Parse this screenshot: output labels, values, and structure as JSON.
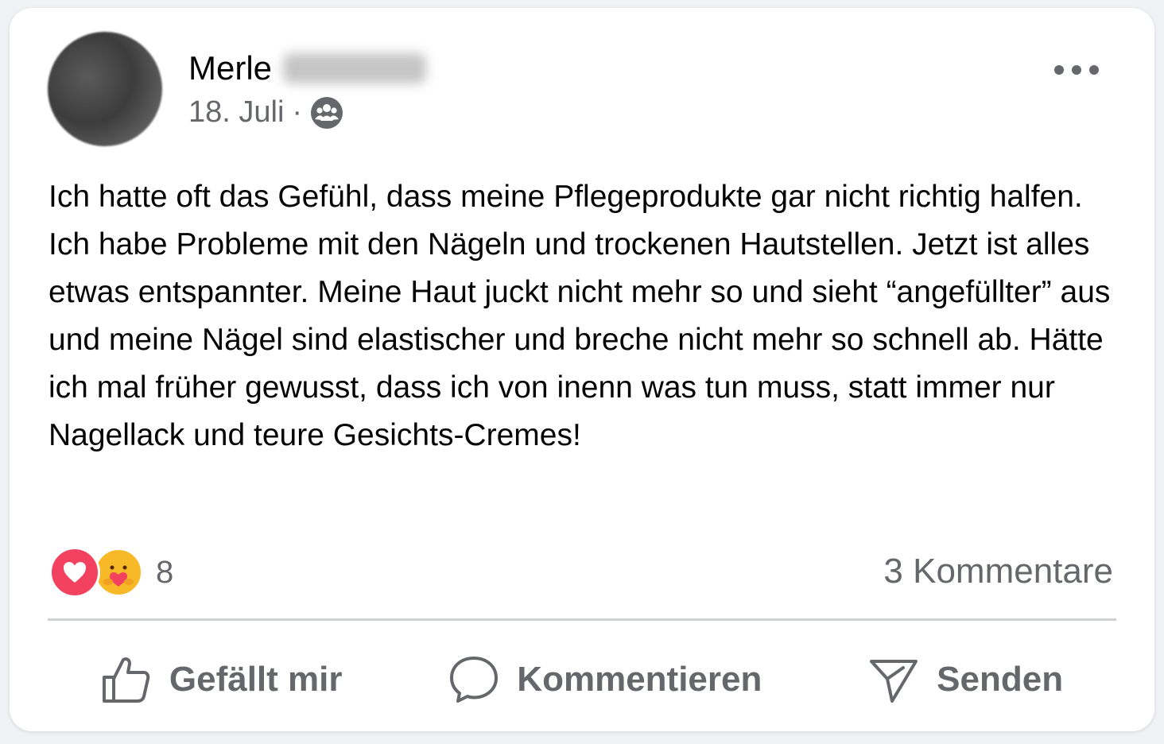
{
  "post": {
    "author_first_name": "Merle",
    "date": "18. Juli",
    "separator": "·",
    "audience_icon": "group-icon",
    "text": "Ich hatte oft das Gefühl, dass meine Pflegeprodukte gar nicht richtig halfen. Ich habe Probleme mit den Nägeln und trockenen Hautstellen. Jetzt ist alles etwas entspannter. Meine Haut juckt nicht mehr so und sieht “angefüllter” aus und meine Nägel sind elastischer und breche nicht mehr so schnell ab. Hätte ich mal früher gewusst, dass ich von inenn was tun muss, statt immer nur Nagellack und teure Gesichts-Cremes!"
  },
  "reactions": {
    "count": "8",
    "types": [
      "heart-icon",
      "care-icon"
    ]
  },
  "comments_label": "3 Kommentare",
  "actions": {
    "like": "Gefällt mir",
    "comment": "Kommentieren",
    "send": "Senden"
  },
  "colors": {
    "text_primary": "#050505",
    "text_secondary": "#65676b",
    "heart": "#f3425f",
    "care": "#f7b928",
    "divider": "#ced0d4"
  }
}
